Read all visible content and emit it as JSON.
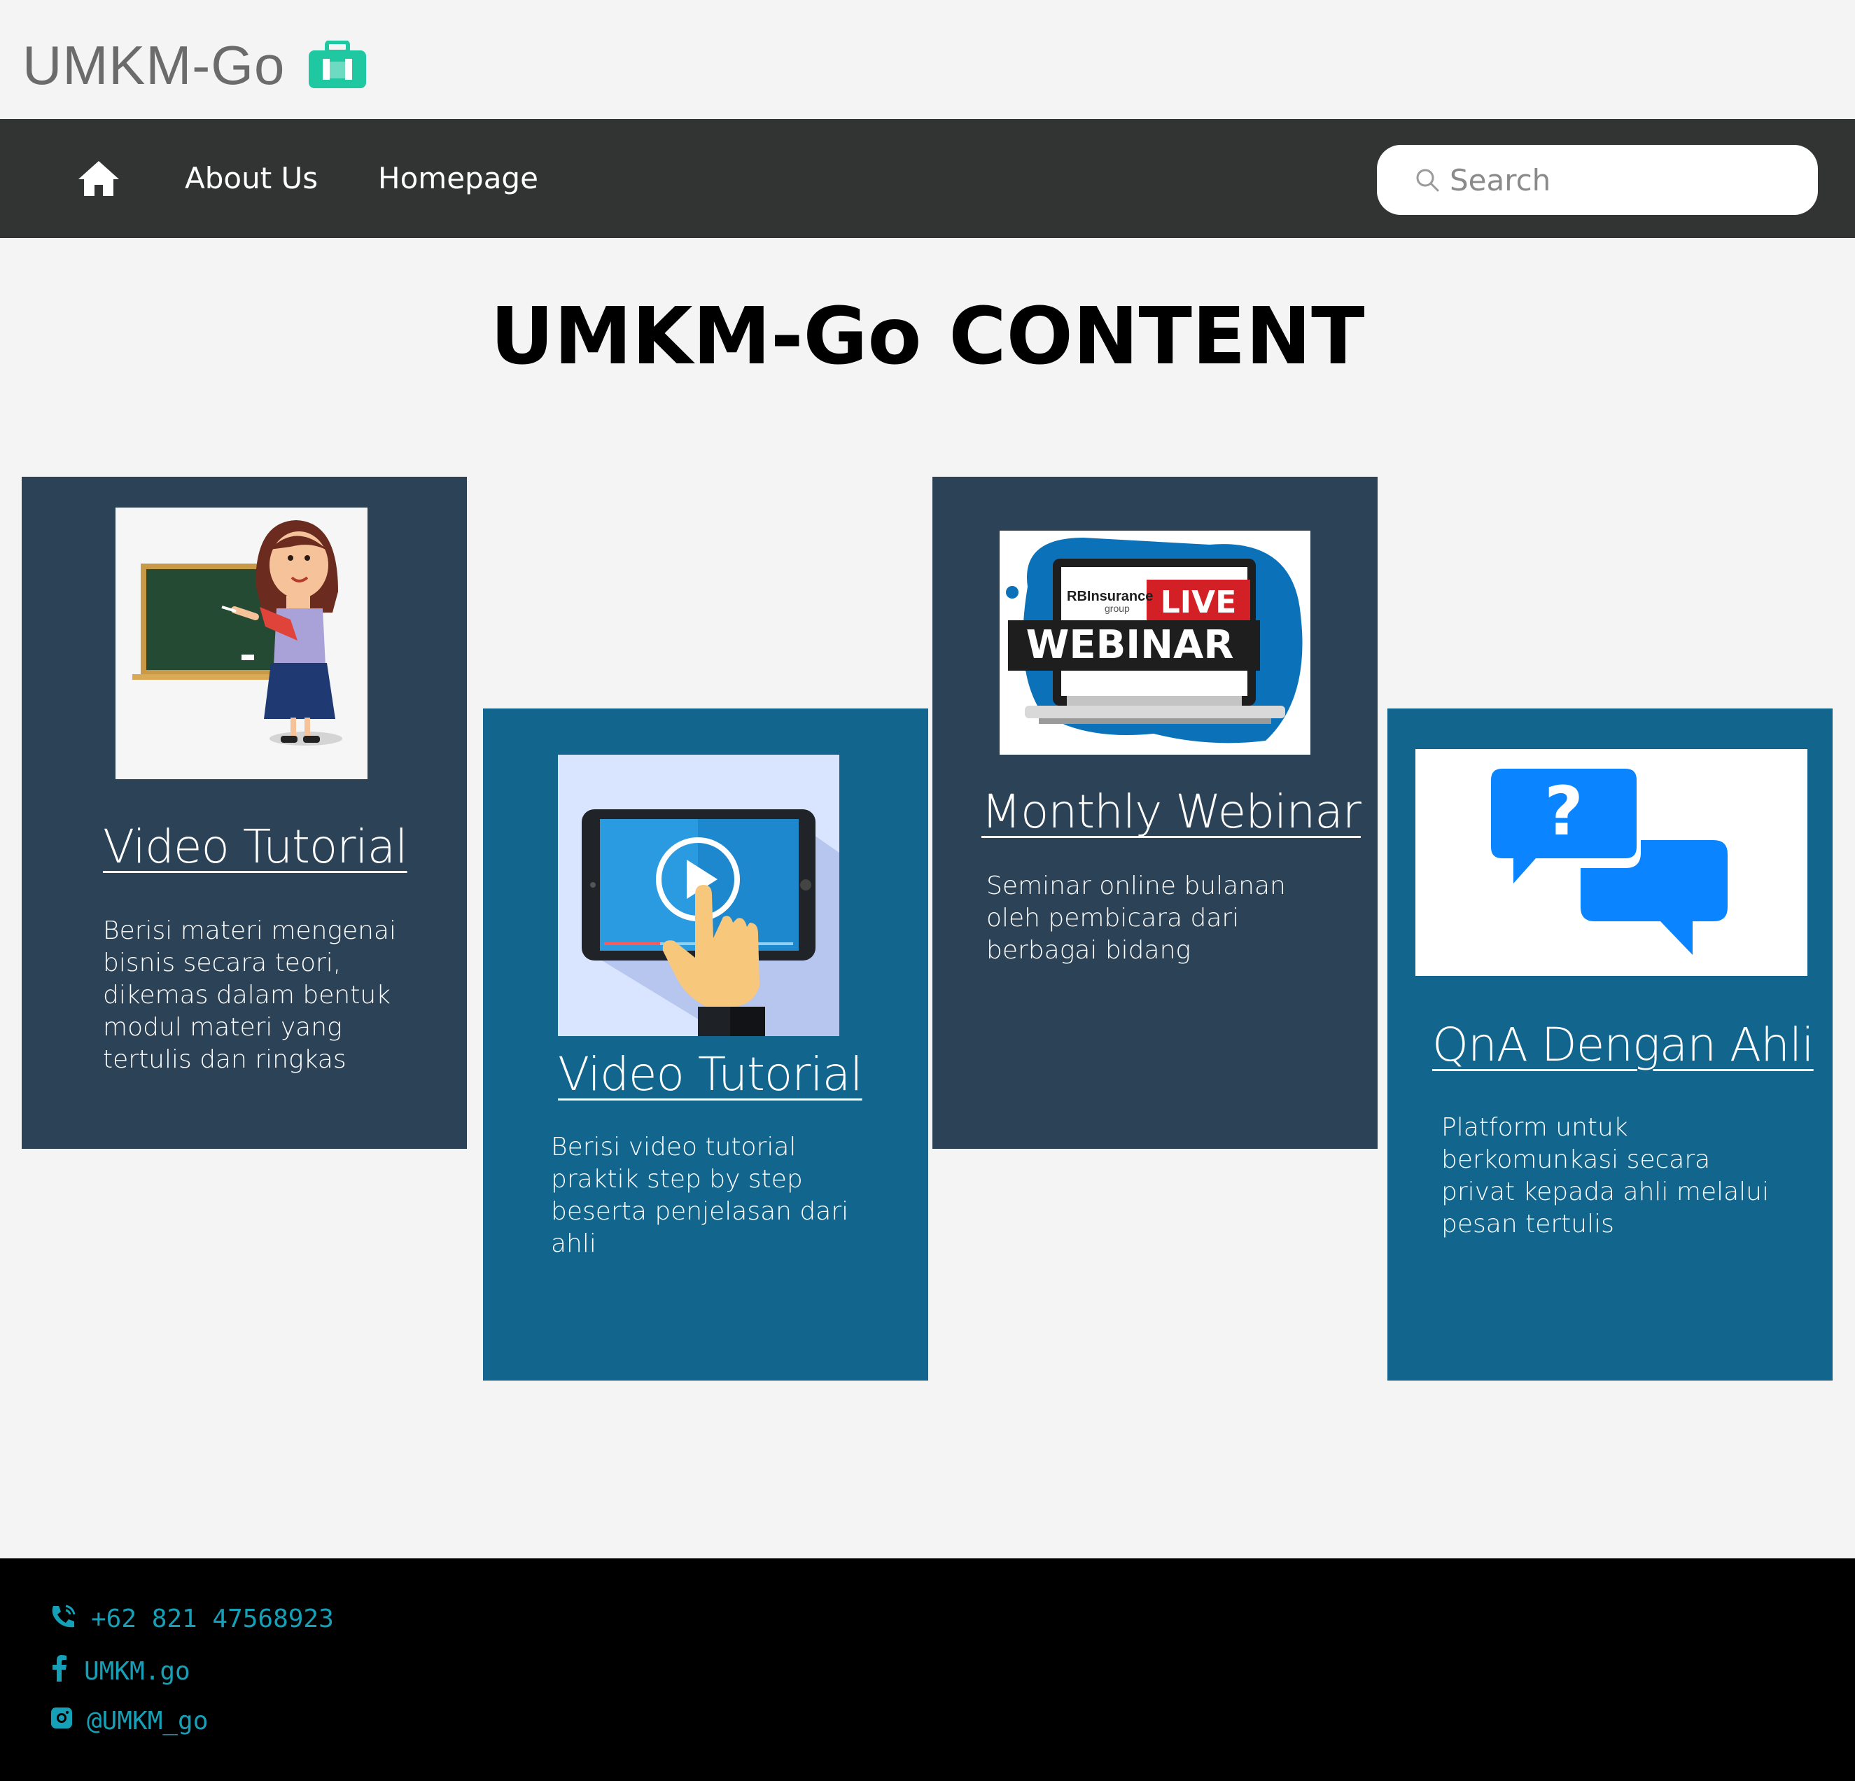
{
  "brand": {
    "name": "UMKM-Go",
    "icon": "briefcase-icon",
    "icon_color": "#1fc8a0"
  },
  "nav": {
    "home_icon": "home-icon",
    "items": [
      {
        "label": "About Us"
      },
      {
        "label": "Homepage"
      }
    ],
    "search": {
      "placeholder": "Search",
      "icon": "search-icon"
    }
  },
  "main": {
    "title": "UMKM-Go CONTENT",
    "cards": [
      {
        "title": "Video Tutorial",
        "description": "Berisi materi mengenai bisnis secara teori, dikemas dalam bentuk modul materi yang tertulis dan ringkas",
        "image": "teacher-illustration",
        "bg": "#2c4257"
      },
      {
        "title": "Video Tutorial",
        "description": "Berisi video tutorial praktik step by step beserta penjelasan dari ahli",
        "image": "tablet-video-illustration",
        "bg": "#12658c"
      },
      {
        "title": "Monthly Webinar",
        "description": "Seminar online bulanan oleh pembicara dari berbagai bidang",
        "image": "live-webinar-illustration",
        "image_text": {
          "brand": "RBInsurance",
          "brand_sub": "group",
          "live": "LIVE",
          "webinar": "WEBINAR"
        },
        "bg": "#2c4257"
      },
      {
        "title": "QnA Dengan Ahli",
        "description": "Platform untuk berkomunkasi secara privat kepada ahli melalui pesan tertulis",
        "image": "question-chat-illustration",
        "bg": "#12658c"
      }
    ]
  },
  "footer": {
    "phone": {
      "icon": "phone-icon",
      "text": "+62 821 47568923"
    },
    "facebook": {
      "icon": "facebook-icon",
      "text": "UMKM.go"
    },
    "instagram": {
      "icon": "instagram-icon",
      "text": "@UMKM_go"
    },
    "text_color": "#15a0b8"
  }
}
